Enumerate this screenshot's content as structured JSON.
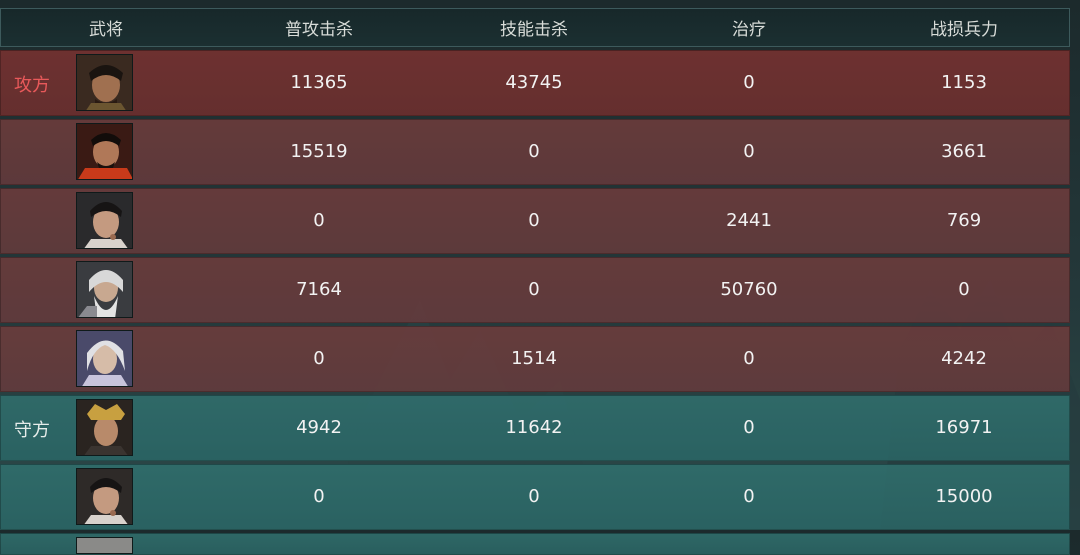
{
  "header": {
    "general": "武将",
    "normal_kills": "普攻击杀",
    "skill_kills": "技能击杀",
    "heal": "治疗",
    "losses": "战损兵力"
  },
  "sides": {
    "attacker": "攻方",
    "defender": "守方"
  },
  "colors": {
    "attacker_label": "#e8595a",
    "attacker_row": "#78322f",
    "defender_row": "#306e6c"
  },
  "rows": [
    {
      "side": "attacker",
      "portrait": "general-portrait-1-icon",
      "normal_kills": "11365",
      "skill_kills": "43745",
      "heal": "0",
      "losses": "1153"
    },
    {
      "side": "attacker",
      "portrait": "general-portrait-2-icon",
      "normal_kills": "15519",
      "skill_kills": "0",
      "heal": "0",
      "losses": "3661"
    },
    {
      "side": "attacker",
      "portrait": "general-portrait-3-icon",
      "normal_kills": "0",
      "skill_kills": "0",
      "heal": "2441",
      "losses": "769"
    },
    {
      "side": "attacker",
      "portrait": "general-portrait-4-icon",
      "normal_kills": "7164",
      "skill_kills": "0",
      "heal": "50760",
      "losses": "0"
    },
    {
      "side": "attacker",
      "portrait": "general-portrait-5-icon",
      "normal_kills": "0",
      "skill_kills": "1514",
      "heal": "0",
      "losses": "4242"
    },
    {
      "side": "defender",
      "portrait": "general-portrait-6-icon",
      "normal_kills": "4942",
      "skill_kills": "11642",
      "heal": "0",
      "losses": "16971"
    },
    {
      "side": "defender",
      "portrait": "general-portrait-7-icon",
      "normal_kills": "0",
      "skill_kills": "0",
      "heal": "0",
      "losses": "15000"
    }
  ]
}
